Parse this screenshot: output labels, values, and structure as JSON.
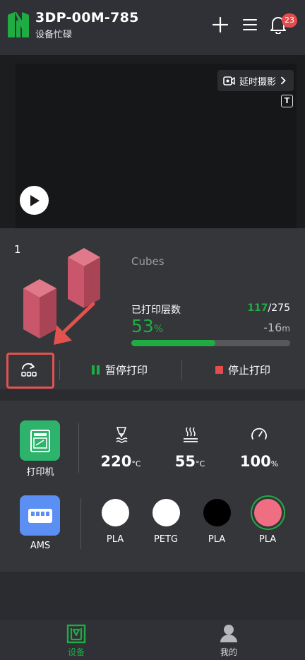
{
  "header": {
    "device_name": "3DP-00M-785",
    "device_status": "设备忙碌",
    "notification_count": "23"
  },
  "video": {
    "timelapse_label": "延时摄影",
    "t_label": "T"
  },
  "print_job": {
    "plate_number": "1",
    "job_name": "Cubes",
    "layers_label": "已打印层数",
    "layers_current": "117",
    "layers_total": "/275",
    "progress_percent": "53",
    "progress_unit": "%",
    "progress_fraction": 0.53,
    "remaining_value": "-16",
    "remaining_unit": "m",
    "pause_label": "暂停打印",
    "stop_label": "停止打印"
  },
  "controls": {
    "printer_label": "打印机",
    "ams_label": "AMS",
    "nozzle_temp": "220",
    "nozzle_unit": "°C",
    "bed_temp": "55",
    "bed_unit": "°C",
    "fan_speed": "100",
    "fan_unit": "%"
  },
  "filaments": [
    {
      "label": "PLA",
      "color": "#ffffff"
    },
    {
      "label": "PETG",
      "color": "#ffffff"
    },
    {
      "label": "PLA",
      "color": "#000000"
    },
    {
      "label": "PLA",
      "color": "#f06e82"
    }
  ],
  "nav": {
    "device_label": "设备",
    "me_label": "我的"
  },
  "colors": {
    "accent_green": "#1fad43",
    "alert_red": "#e34d4d",
    "printer_tile": "#2db36b",
    "ams_tile": "#5b8ff3"
  }
}
